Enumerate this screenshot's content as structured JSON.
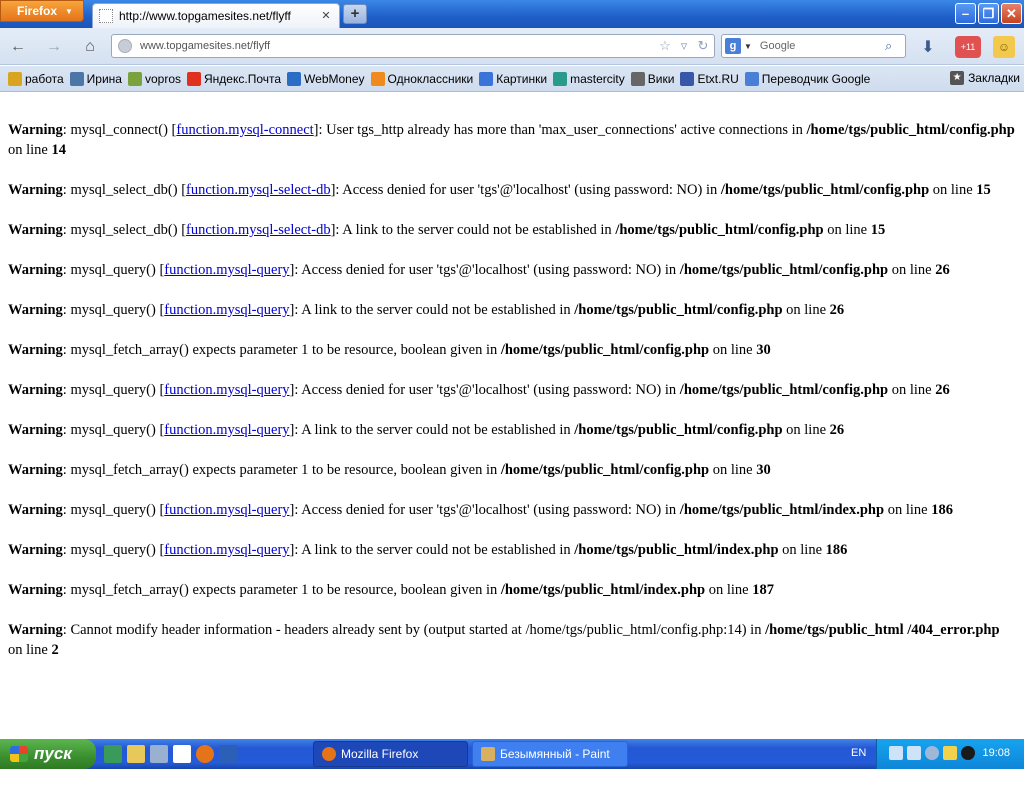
{
  "browser": {
    "menu_button": "Firefox",
    "tab": {
      "title": "http://www.topgamesites.net/flyff"
    },
    "new_tab": "+",
    "url": "www.topgamesites.net/flyff",
    "search_placeholder": "Google",
    "search_engine_letter": "g"
  },
  "bookmarks": [
    {
      "label": "работа",
      "icon": "folder-icon",
      "color": "#d9a520"
    },
    {
      "label": "Ирина",
      "icon": "vk-icon",
      "color": "#4a76a8"
    },
    {
      "label": "vopros",
      "icon": "question-icon",
      "color": "#7aa340"
    },
    {
      "label": "Яндекс.Почта",
      "icon": "yandex-icon",
      "color": "#e0301e"
    },
    {
      "label": "WebMoney",
      "icon": "webmoney-icon",
      "color": "#2b6cc4"
    },
    {
      "label": "Одноклассники",
      "icon": "odnoklassniki-icon",
      "color": "#ef8a1e"
    },
    {
      "label": "Картинки",
      "icon": "google-icon",
      "color": "#3a74d8"
    },
    {
      "label": "mastercity",
      "icon": "mc-icon",
      "color": "#2a9a8a"
    },
    {
      "label": "Вики",
      "icon": "wiki-icon",
      "color": "#666666"
    },
    {
      "label": "Etxt.RU",
      "icon": "etxt-icon",
      "color": "#3857a8"
    },
    {
      "label": "Переводчик Google",
      "icon": "translate-icon",
      "color": "#4a7fd8"
    }
  ],
  "bookmarks_menu": "Закладки",
  "warnings": [
    {
      "label": "Warning",
      "pre": ": mysql_connect() [",
      "link": "function.mysql-connect",
      "mid": "]: User tgs_http already has more than 'max_user_connections' active connections in ",
      "path": "/home/tgs/public_html/config.php",
      "online": " on line ",
      "line": "14"
    },
    {
      "label": "Warning",
      "pre": ": mysql_select_db() [",
      "link": "function.mysql-select-db",
      "mid": "]: Access denied for user 'tgs'@'localhost' (using password: NO) in ",
      "path": "/home/tgs/public_html/config.php",
      "online": " on line ",
      "line": "15"
    },
    {
      "label": "Warning",
      "pre": ": mysql_select_db() [",
      "link": "function.mysql-select-db",
      "mid": "]: A link to the server could not be established in ",
      "path": "/home/tgs/public_html/config.php",
      "online": " on line ",
      "line": "15"
    },
    {
      "label": "Warning",
      "pre": ": mysql_query() [",
      "link": "function.mysql-query",
      "mid": "]: Access denied for user 'tgs'@'localhost' (using password: NO) in ",
      "path": "/home/tgs/public_html/config.php",
      "online": " on line ",
      "line": "26"
    },
    {
      "label": "Warning",
      "pre": ": mysql_query() [",
      "link": "function.mysql-query",
      "mid": "]: A link to the server could not be established in ",
      "path": "/home/tgs/public_html/config.php",
      "online": " on line ",
      "line": "26"
    },
    {
      "label": "Warning",
      "pre": ": mysql_fetch_array() expects parameter 1 to be resource, boolean given in ",
      "link": "",
      "mid": "",
      "path": "/home/tgs/public_html/config.php",
      "online": " on line ",
      "line": "30"
    },
    {
      "label": "Warning",
      "pre": ": mysql_query() [",
      "link": "function.mysql-query",
      "mid": "]: Access denied for user 'tgs'@'localhost' (using password: NO) in ",
      "path": "/home/tgs/public_html/config.php",
      "online": " on line ",
      "line": "26"
    },
    {
      "label": "Warning",
      "pre": ": mysql_query() [",
      "link": "function.mysql-query",
      "mid": "]: A link to the server could not be established in ",
      "path": "/home/tgs/public_html/config.php",
      "online": " on line ",
      "line": "26"
    },
    {
      "label": "Warning",
      "pre": ": mysql_fetch_array() expects parameter 1 to be resource, boolean given in ",
      "link": "",
      "mid": "",
      "path": "/home/tgs/public_html/config.php",
      "online": " on line ",
      "line": "30"
    },
    {
      "label": "Warning",
      "pre": ": mysql_query() [",
      "link": "function.mysql-query",
      "mid": "]: Access denied for user 'tgs'@'localhost' (using password: NO) in ",
      "path": "/home/tgs/public_html/index.php",
      "online": " on line ",
      "line": "186"
    },
    {
      "label": "Warning",
      "pre": ": mysql_query() [",
      "link": "function.mysql-query",
      "mid": "]: A link to the server could not be established in ",
      "path": "/home/tgs/public_html/index.php",
      "online": " on line ",
      "line": "186"
    },
    {
      "label": "Warning",
      "pre": ": mysql_fetch_array() expects parameter 1 to be resource, boolean given in ",
      "link": "",
      "mid": "",
      "path": "/home/tgs/public_html/index.php",
      "online": " on line ",
      "line": "187"
    },
    {
      "label": "Warning",
      "pre": ": Cannot modify header information - headers already sent by (output started at /home/tgs/public_html/config.php:14) in ",
      "link": "",
      "mid": "",
      "path": "/home/tgs/public_html /404_error.php",
      "online": " on line ",
      "line": "2"
    }
  ],
  "taskbar": {
    "start_label": "пуск",
    "tasks": [
      {
        "label": "Mozilla Firefox",
        "icon": "firefox-icon",
        "color": "#e5731a"
      },
      {
        "label": "Безымянный - Paint",
        "icon": "paint-icon",
        "color": "#d8b060"
      }
    ],
    "language": "EN",
    "clock": "19:08"
  },
  "colors": {
    "link": "#0000cc",
    "titlebar": "#1f5fc9",
    "taskbar": "#245bd8",
    "tray": "#0f86d8"
  }
}
